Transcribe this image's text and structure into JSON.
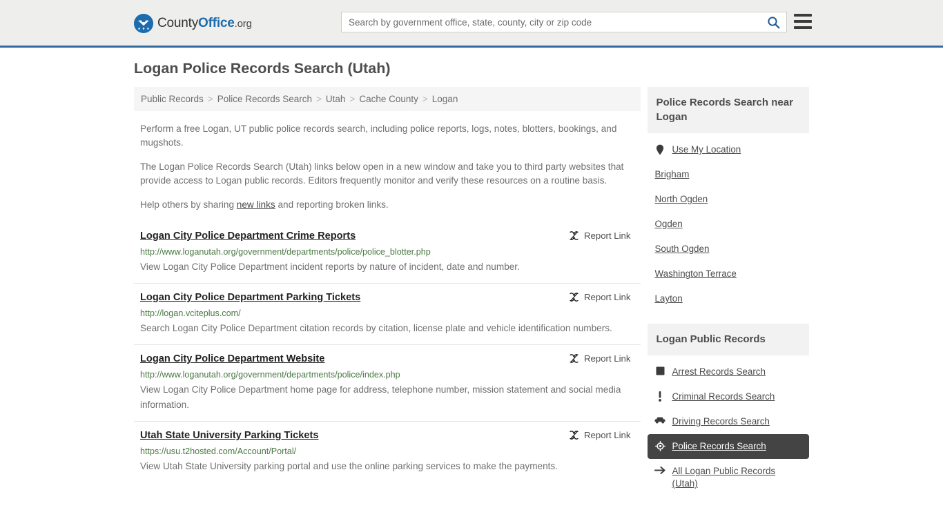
{
  "header": {
    "logo": {
      "name": "CountyOffice.org",
      "part1": "County",
      "part2": "Office",
      "part3": ".org",
      "icon": "eagle-shield-logo-icon"
    },
    "search": {
      "placeholder": "Search by government office, state, county, city or zip code",
      "value": "",
      "search_icon": "search-icon"
    },
    "menu_icon": "hamburger-menu-icon",
    "accent_color": "#31699e",
    "background_color": "#eeeeec"
  },
  "page_title": "Logan Police Records Search (Utah)",
  "breadcrumb": {
    "items": [
      {
        "label": "Public Records"
      },
      {
        "label": "Police Records Search"
      },
      {
        "label": "Utah"
      },
      {
        "label": "Cache County"
      },
      {
        "label": "Logan"
      }
    ],
    "separator": ">"
  },
  "intro": {
    "paragraph1": "Perform a free Logan, UT public police records search, including police reports, logs, notes, blotters, bookings, and mugshots.",
    "paragraph2": "The Logan Police Records Search (Utah) links below open in a new window and take you to third party websites that provide access to Logan public records. Editors frequently monitor and verify these resources on a routine basis.",
    "paragraph3_pre": "Help others by sharing ",
    "paragraph3_link": "new links",
    "paragraph3_post": " and reporting broken links."
  },
  "results": {
    "report_label": "Report Link",
    "report_icon": "broken-link-icon",
    "items": [
      {
        "title": "Logan City Police Department Crime Reports",
        "url": "http://www.loganutah.org/government/departments/police/police_blotter.php",
        "description": "View Logan City Police Department incident reports by nature of incident, date and number."
      },
      {
        "title": "Logan City Police Department Parking Tickets",
        "url": "http://logan.vciteplus.com/",
        "description": "Search Logan City Police Department citation records by citation, license plate and vehicle identification numbers."
      },
      {
        "title": "Logan City Police Department Website",
        "url": "http://www.loganutah.org/government/departments/police/index.php",
        "description": "View Logan City Police Department home page for address, telephone number, mission statement and social media information."
      },
      {
        "title": "Utah State University Parking Tickets",
        "url": "https://usu.t2hosted.com/Account/Portal/",
        "description": "View Utah State University parking portal and use the online parking services to make the payments."
      }
    ]
  },
  "sidebar": {
    "nearby": {
      "heading": "Police Records Search near Logan",
      "items": [
        {
          "label": "Use My Location",
          "icon": "location-pin-icon"
        },
        {
          "label": "Brigham",
          "icon": ""
        },
        {
          "label": "North Ogden",
          "icon": ""
        },
        {
          "label": "Ogden",
          "icon": ""
        },
        {
          "label": "South Ogden",
          "icon": ""
        },
        {
          "label": "Washington Terrace",
          "icon": ""
        },
        {
          "label": "Layton",
          "icon": ""
        }
      ]
    },
    "public_records": {
      "heading": "Logan Public Records",
      "items": [
        {
          "label": "Arrest Records Search",
          "icon": "fingerprint-square-icon",
          "active": false
        },
        {
          "label": "Criminal Records Search",
          "icon": "exclamation-icon",
          "active": false
        },
        {
          "label": "Driving Records Search",
          "icon": "car-icon",
          "active": false
        },
        {
          "label": "Police Records Search",
          "icon": "police-badge-icon",
          "active": true
        },
        {
          "label": "All Logan Public Records (Utah)",
          "icon": "arrow-right-icon",
          "active": false
        }
      ],
      "active_background": "#444444"
    }
  }
}
